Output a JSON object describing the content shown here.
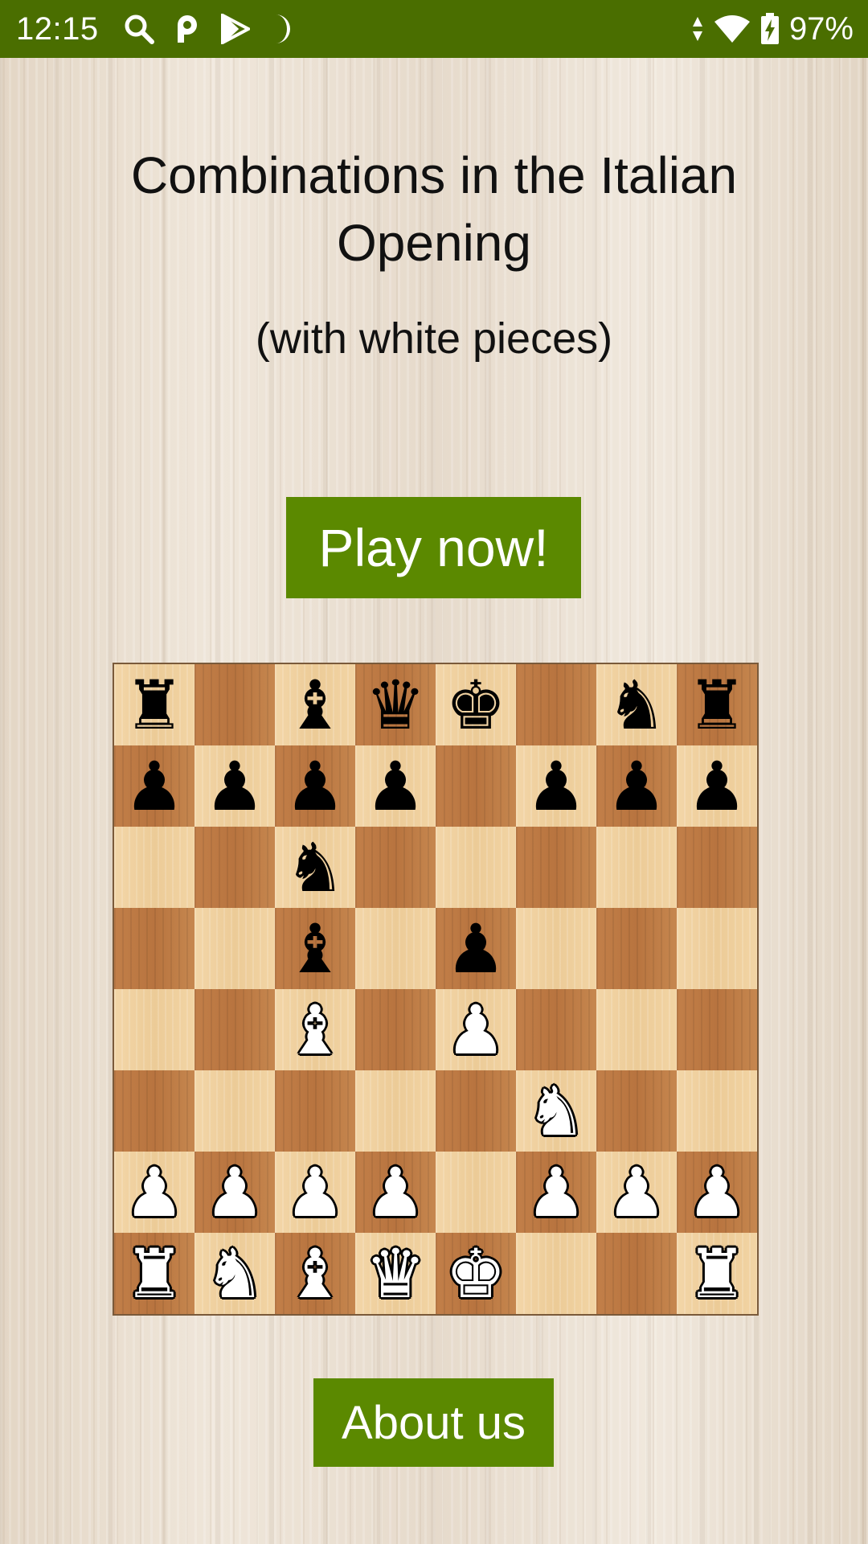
{
  "status_bar": {
    "time": "12:15",
    "left_icons": [
      "search-icon",
      "p-icon",
      "play-store-icon",
      "do-not-disturb-moon-icon"
    ],
    "right_icons": [
      "data-arrows-icon",
      "wifi-icon",
      "battery-charging-icon"
    ],
    "battery": "97%"
  },
  "header": {
    "title": "Combinations in the Italian Opening",
    "subtitle": "(with white pieces)"
  },
  "buttons": {
    "play": "Play now!",
    "about": "About us"
  },
  "colors": {
    "status_bar": "#4a6e00",
    "button": "#5b8900",
    "light_square": "#f0cf9c",
    "dark_square": "#c4824c"
  },
  "board": {
    "fen": "r1bqk1nr/pppp1ppp/2n5/2b1p3/2B1P3/5N2/PPPP1PPP/RNBQK2R",
    "orientation": "white",
    "rows": [
      [
        "r",
        "",
        "b",
        "q",
        "k",
        "",
        "n",
        "r"
      ],
      [
        "p",
        "p",
        "p",
        "p",
        "",
        "p",
        "p",
        "p"
      ],
      [
        "",
        "",
        "n",
        "",
        "",
        "",
        "",
        ""
      ],
      [
        "",
        "",
        "b",
        "",
        "p",
        "",
        "",
        ""
      ],
      [
        "",
        "",
        "B",
        "",
        "P",
        "",
        "",
        ""
      ],
      [
        "",
        "",
        "",
        "",
        "",
        "N",
        "",
        ""
      ],
      [
        "P",
        "P",
        "P",
        "P",
        "",
        "P",
        "P",
        "P"
      ],
      [
        "R",
        "N",
        "B",
        "Q",
        "K",
        "",
        "",
        "R"
      ]
    ]
  }
}
